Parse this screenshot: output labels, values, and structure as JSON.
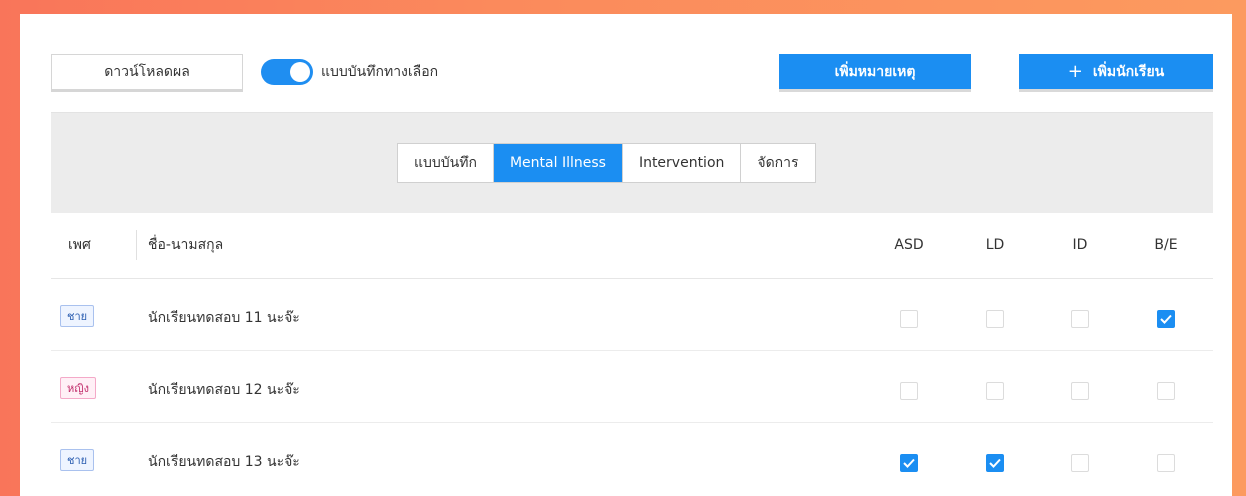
{
  "toolbar": {
    "download_label": "ดาวน์โหลดผล",
    "toggle_label": "แบบบันทึกทางเลือก",
    "toggle_on": true,
    "add_note_label": "เพิ่มหมายเหตุ",
    "add_student_label": "เพิ่มนักเรียน",
    "add_student_icon": "plus-icon"
  },
  "tabs": [
    {
      "label": "แบบบันทึก",
      "active": false
    },
    {
      "label": "Mental Illness",
      "active": true
    },
    {
      "label": "Intervention",
      "active": false
    },
    {
      "label": "จัดการ",
      "active": false
    }
  ],
  "table": {
    "headers": {
      "sex": "เพศ",
      "name": "ชื่อ-นามสกุล",
      "asd": "ASD",
      "ld": "LD",
      "id": "ID",
      "be": "B/E"
    },
    "rows": [
      {
        "sex": "ชาย",
        "sex_type": "male",
        "name": "นักเรียนทดสอบ 11 นะจ๊ะ",
        "asd": false,
        "ld": false,
        "id": false,
        "be": true
      },
      {
        "sex": "หญิง",
        "sex_type": "female",
        "name": "นักเรียนทดสอบ 12 นะจ๊ะ",
        "asd": false,
        "ld": false,
        "id": false,
        "be": false
      },
      {
        "sex": "ชาย",
        "sex_type": "male",
        "name": "นักเรียนทดสอบ 13 นะจ๊ะ",
        "asd": true,
        "ld": true,
        "id": false,
        "be": false
      }
    ]
  },
  "colors": {
    "primary": "#1b8ef2",
    "background_gradient_start": "#f9755a",
    "background_gradient_end": "#fc9a5f",
    "male_badge": "#2a5db0",
    "female_badge": "#c2306d"
  }
}
